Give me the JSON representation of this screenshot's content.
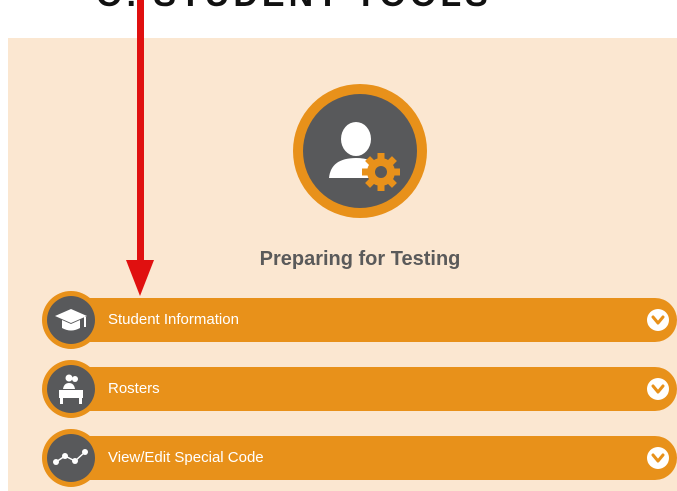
{
  "header": {
    "clipped_text": "O. STUDENT TOOLS"
  },
  "hero": {
    "icon": "user-gear-icon",
    "title": "Preparing for Testing"
  },
  "colors": {
    "accent": "#e8911a",
    "panel_bg": "#fbe7d1",
    "icon_bg": "#58595b",
    "annotation_arrow": "#e01010"
  },
  "sections": [
    {
      "label": "Student Information",
      "icon": "graduation-cap-icon"
    },
    {
      "label": "Rosters",
      "icon": "classroom-icon"
    },
    {
      "label": "View/Edit Special Code",
      "icon": "network-line-icon"
    }
  ]
}
